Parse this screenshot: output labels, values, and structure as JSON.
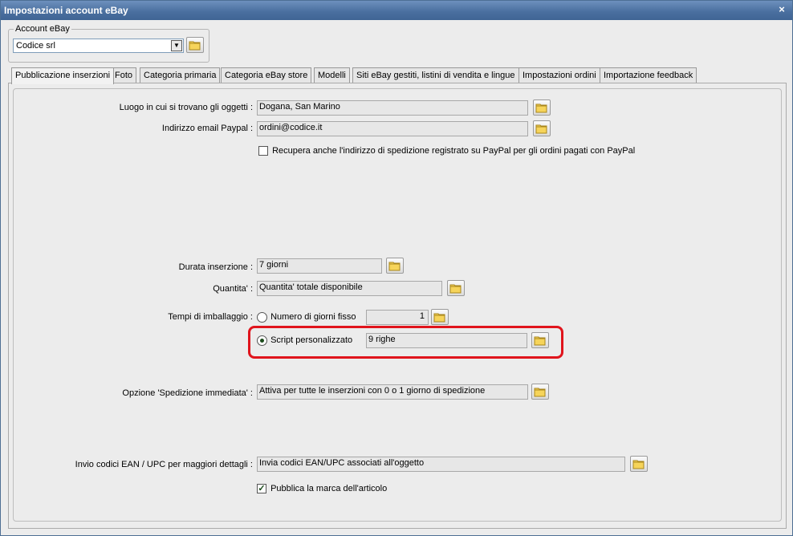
{
  "window": {
    "title": "Impostazioni account eBay",
    "close_glyph": "×"
  },
  "account": {
    "group_label": "Account eBay",
    "selected": "Codice srl"
  },
  "tabs": [
    {
      "label": "Pubblicazione inserzioni",
      "active": true
    },
    {
      "label": "Foto"
    },
    {
      "label": "Categoria primaria"
    },
    {
      "label": "Categoria eBay store"
    },
    {
      "label": "Modelli"
    },
    {
      "label": "Siti eBay gestiti, listini di vendita e lingue"
    },
    {
      "label": "Impostazioni ordini"
    },
    {
      "label": "Importazione feedback"
    }
  ],
  "form": {
    "location_label": "Luogo in cui si trovano gli oggetti :",
    "location_value": "Dogana, San Marino",
    "paypal_label": "Indirizzo email Paypal :",
    "paypal_value": "ordini@codice.it",
    "paypal_checkbox_label": "Recupera anche l'indirizzo di spedizione registrato su PayPal per gli ordini pagati con PayPal",
    "paypal_checkbox_checked": false,
    "duration_label": "Durata inserzione :",
    "duration_value": "7 giorni",
    "quantity_label": "Quantita' :",
    "quantity_value": "Quantita' totale disponibile",
    "packing_label": "Tempi di imballaggio :",
    "packing_fixed_label": "Numero di giorni fisso",
    "packing_fixed_value": "1",
    "packing_script_label": "Script personalizzato",
    "packing_script_value": "9 righe",
    "packing_selected": "script",
    "immediate_label": "Opzione 'Spedizione immediata' :",
    "immediate_value": "Attiva per tutte le inserzioni con 0 o 1 giorno di spedizione",
    "ean_label": "Invio codici EAN / UPC per maggiori dettagli :",
    "ean_value": "Invia codici EAN/UPC associati all'oggetto",
    "brand_checkbox_label": "Pubblica la marca dell'articolo",
    "brand_checkbox_checked": true
  },
  "icons": {
    "folder": "folder-icon",
    "checkmark": "✓"
  },
  "colors": {
    "highlight": "#e0141c",
    "title_bar": "#4b70a0"
  }
}
